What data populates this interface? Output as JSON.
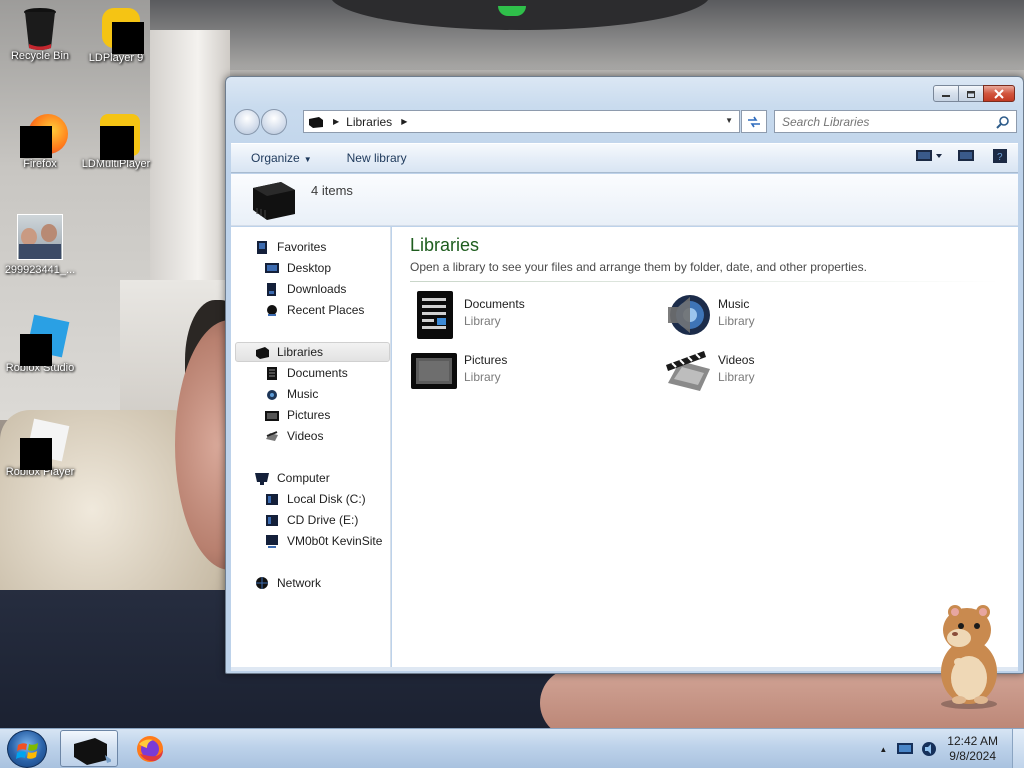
{
  "desktop": {
    "icons": [
      {
        "label": "Recycle Bin"
      },
      {
        "label": "LDPlayer 9"
      },
      {
        "label": "Firefox"
      },
      {
        "label": "LDMultiPlayer"
      },
      {
        "label": "299923441_..."
      },
      {
        "label": "Roblox Studio"
      },
      {
        "label": "Roblox Player"
      }
    ]
  },
  "window": {
    "address": {
      "crumbs": [
        "Libraries"
      ]
    },
    "search": {
      "placeholder": "Search Libraries"
    },
    "toolbar": {
      "organize": "Organize",
      "new_library": "New library"
    },
    "info": {
      "count": "4 items"
    },
    "nav": {
      "favorites": {
        "header": "Favorites",
        "items": [
          "Desktop",
          "Downloads",
          "Recent Places"
        ]
      },
      "libraries": {
        "header": "Libraries",
        "items": [
          "Documents",
          "Music",
          "Pictures",
          "Videos"
        ]
      },
      "computer": {
        "header": "Computer",
        "items": [
          "Local Disk (C:)",
          "CD Drive (E:)",
          "VM0b0t KevinSite"
        ]
      },
      "network": {
        "header": "Network"
      }
    },
    "content": {
      "title": "Libraries",
      "subtitle": "Open a library to see your files and arrange them by folder, date, and other properties.",
      "libraries": [
        {
          "name": "Documents",
          "type": "Library",
          "icon": "documents-library-icon"
        },
        {
          "name": "Music",
          "type": "Library",
          "icon": "music-library-icon"
        },
        {
          "name": "Pictures",
          "type": "Library",
          "icon": "pictures-library-icon"
        },
        {
          "name": "Videos",
          "type": "Library",
          "icon": "videos-library-icon"
        }
      ]
    }
  },
  "taskbar": {
    "clock": {
      "time": "12:42 AM",
      "date": "9/8/2024"
    }
  },
  "colors": {
    "title_green": "#1e5d1e",
    "taskbar": "#bdd2ea",
    "close_red": "#c23a23"
  }
}
